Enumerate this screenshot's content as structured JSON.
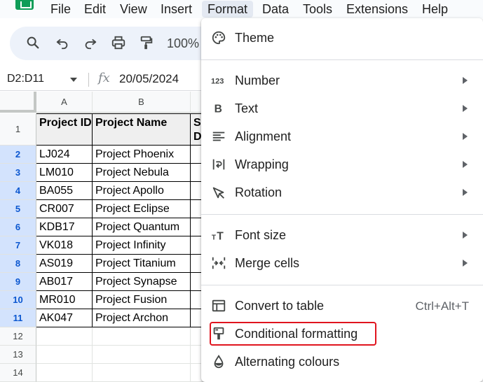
{
  "menubar": {
    "items": [
      "File",
      "Edit",
      "View",
      "Insert",
      "Format",
      "Data",
      "Tools",
      "Extensions",
      "Help"
    ],
    "active": "Format"
  },
  "toolbar": {
    "zoom": "100%",
    "icons": [
      "search-icon",
      "undo-icon",
      "redo-icon",
      "print-icon",
      "paint-format-icon"
    ]
  },
  "formula_bar": {
    "name_box": "D2:D11",
    "fx": "fx",
    "value": "20/05/2024"
  },
  "grid": {
    "columns": [
      "A",
      "B"
    ],
    "rows": [
      "1",
      "2",
      "3",
      "4",
      "5",
      "6",
      "7",
      "8",
      "9",
      "10",
      "11",
      "12",
      "13",
      "14"
    ],
    "header": [
      "Project ID",
      "Project Name",
      "S D"
    ],
    "data": [
      [
        "LJ024",
        "Project Phoenix"
      ],
      [
        "LM010",
        "Project Nebula"
      ],
      [
        "BA055",
        "Project Apollo"
      ],
      [
        "CR007",
        "Project Eclipse"
      ],
      [
        "KDB17",
        "Project Quantum"
      ],
      [
        "VK018",
        "Project Infinity"
      ],
      [
        "AS019",
        "Project Titanium"
      ],
      [
        "AB017",
        "Project Synapse"
      ],
      [
        "MR010",
        "Project Fusion"
      ],
      [
        "AK047",
        "Project Archon"
      ]
    ]
  },
  "format_menu": {
    "items": [
      {
        "label": "Theme",
        "icon": "palette-icon"
      },
      {
        "label": "Number",
        "icon": "number-123-icon",
        "submenu": true
      },
      {
        "label": "Text",
        "icon": "bold-icon",
        "submenu": true
      },
      {
        "label": "Alignment",
        "icon": "align-left-icon",
        "submenu": true
      },
      {
        "label": "Wrapping",
        "icon": "wrap-icon",
        "submenu": true
      },
      {
        "label": "Rotation",
        "icon": "rotation-icon",
        "submenu": true
      },
      {
        "label": "Font size",
        "icon": "font-size-icon",
        "submenu": true
      },
      {
        "label": "Merge cells",
        "icon": "merge-cells-icon",
        "submenu": true
      },
      {
        "label": "Convert to table",
        "icon": "table-icon",
        "shortcut": "Ctrl+Alt+T"
      },
      {
        "label": "Conditional formatting",
        "icon": "paint-roller-icon"
      },
      {
        "label": "Alternating colours",
        "icon": "fill-drop-icon"
      }
    ],
    "highlighted": "Conditional formatting",
    "highlight_color": "#e0141e"
  }
}
